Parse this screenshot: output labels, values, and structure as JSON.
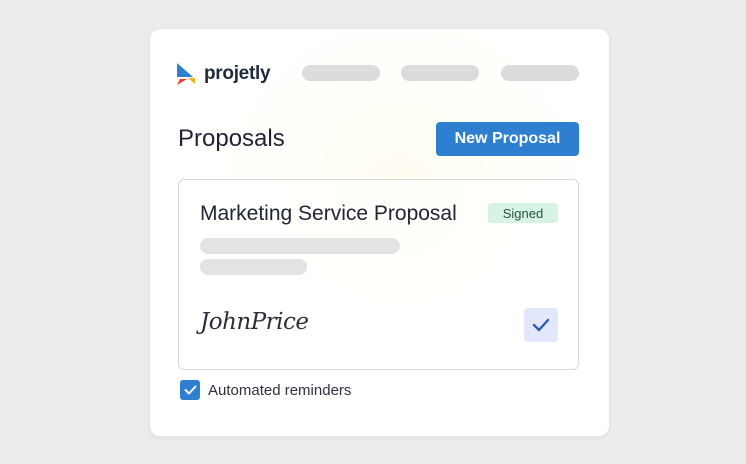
{
  "brand": {
    "name": "projetly",
    "icon": "projetly-logo-icon"
  },
  "nav": {
    "placeholders": 3
  },
  "page": {
    "title": "Proposals"
  },
  "actions": {
    "new_proposal_label": "New Proposal"
  },
  "proposal": {
    "title": "Marketing Service Proposal",
    "status": "Signed",
    "signature": "JohnPrice",
    "signed_checked": true
  },
  "options": {
    "automated_reminders_label": "Automated reminders",
    "automated_reminders_checked": true
  },
  "colors": {
    "accent": "#2f7fd0",
    "badge_bg": "#d6f3e4",
    "badge_text": "#27543d",
    "title_text": "#1e2433"
  }
}
